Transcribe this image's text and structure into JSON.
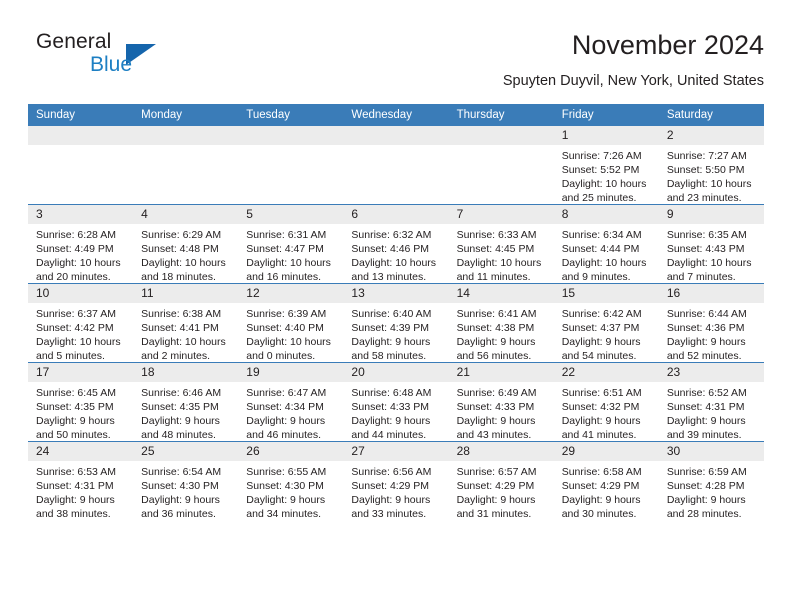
{
  "brand": {
    "name_part1": "General",
    "name_part2": "Blue",
    "triangle_icon": "triangle-icon",
    "accent_color": "#1565ac",
    "text_color": "#1d7fc3"
  },
  "header": {
    "month_title": "November 2024",
    "location": "Spuyten Duyvil, New York, United States",
    "header_bg_color": "#3a7cb8",
    "daynum_band_color": "#ececec"
  },
  "calendar": {
    "weekday_headers": [
      "Sunday",
      "Monday",
      "Tuesday",
      "Wednesday",
      "Thursday",
      "Friday",
      "Saturday"
    ],
    "weeks": [
      [
        {
          "day": "",
          "blank": true
        },
        {
          "day": "",
          "blank": true
        },
        {
          "day": "",
          "blank": true
        },
        {
          "day": "",
          "blank": true
        },
        {
          "day": "",
          "blank": true
        },
        {
          "day": "1",
          "sunrise": "Sunrise: 7:26 AM",
          "sunset": "Sunset: 5:52 PM",
          "daylight": "Daylight: 10 hours and 25 minutes."
        },
        {
          "day": "2",
          "sunrise": "Sunrise: 7:27 AM",
          "sunset": "Sunset: 5:50 PM",
          "daylight": "Daylight: 10 hours and 23 minutes."
        }
      ],
      [
        {
          "day": "3",
          "sunrise": "Sunrise: 6:28 AM",
          "sunset": "Sunset: 4:49 PM",
          "daylight": "Daylight: 10 hours and 20 minutes."
        },
        {
          "day": "4",
          "sunrise": "Sunrise: 6:29 AM",
          "sunset": "Sunset: 4:48 PM",
          "daylight": "Daylight: 10 hours and 18 minutes."
        },
        {
          "day": "5",
          "sunrise": "Sunrise: 6:31 AM",
          "sunset": "Sunset: 4:47 PM",
          "daylight": "Daylight: 10 hours and 16 minutes."
        },
        {
          "day": "6",
          "sunrise": "Sunrise: 6:32 AM",
          "sunset": "Sunset: 4:46 PM",
          "daylight": "Daylight: 10 hours and 13 minutes."
        },
        {
          "day": "7",
          "sunrise": "Sunrise: 6:33 AM",
          "sunset": "Sunset: 4:45 PM",
          "daylight": "Daylight: 10 hours and 11 minutes."
        },
        {
          "day": "8",
          "sunrise": "Sunrise: 6:34 AM",
          "sunset": "Sunset: 4:44 PM",
          "daylight": "Daylight: 10 hours and 9 minutes."
        },
        {
          "day": "9",
          "sunrise": "Sunrise: 6:35 AM",
          "sunset": "Sunset: 4:43 PM",
          "daylight": "Daylight: 10 hours and 7 minutes."
        }
      ],
      [
        {
          "day": "10",
          "sunrise": "Sunrise: 6:37 AM",
          "sunset": "Sunset: 4:42 PM",
          "daylight": "Daylight: 10 hours and 5 minutes."
        },
        {
          "day": "11",
          "sunrise": "Sunrise: 6:38 AM",
          "sunset": "Sunset: 4:41 PM",
          "daylight": "Daylight: 10 hours and 2 minutes."
        },
        {
          "day": "12",
          "sunrise": "Sunrise: 6:39 AM",
          "sunset": "Sunset: 4:40 PM",
          "daylight": "Daylight: 10 hours and 0 minutes."
        },
        {
          "day": "13",
          "sunrise": "Sunrise: 6:40 AM",
          "sunset": "Sunset: 4:39 PM",
          "daylight": "Daylight: 9 hours and 58 minutes."
        },
        {
          "day": "14",
          "sunrise": "Sunrise: 6:41 AM",
          "sunset": "Sunset: 4:38 PM",
          "daylight": "Daylight: 9 hours and 56 minutes."
        },
        {
          "day": "15",
          "sunrise": "Sunrise: 6:42 AM",
          "sunset": "Sunset: 4:37 PM",
          "daylight": "Daylight: 9 hours and 54 minutes."
        },
        {
          "day": "16",
          "sunrise": "Sunrise: 6:44 AM",
          "sunset": "Sunset: 4:36 PM",
          "daylight": "Daylight: 9 hours and 52 minutes."
        }
      ],
      [
        {
          "day": "17",
          "sunrise": "Sunrise: 6:45 AM",
          "sunset": "Sunset: 4:35 PM",
          "daylight": "Daylight: 9 hours and 50 minutes."
        },
        {
          "day": "18",
          "sunrise": "Sunrise: 6:46 AM",
          "sunset": "Sunset: 4:35 PM",
          "daylight": "Daylight: 9 hours and 48 minutes."
        },
        {
          "day": "19",
          "sunrise": "Sunrise: 6:47 AM",
          "sunset": "Sunset: 4:34 PM",
          "daylight": "Daylight: 9 hours and 46 minutes."
        },
        {
          "day": "20",
          "sunrise": "Sunrise: 6:48 AM",
          "sunset": "Sunset: 4:33 PM",
          "daylight": "Daylight: 9 hours and 44 minutes."
        },
        {
          "day": "21",
          "sunrise": "Sunrise: 6:49 AM",
          "sunset": "Sunset: 4:33 PM",
          "daylight": "Daylight: 9 hours and 43 minutes."
        },
        {
          "day": "22",
          "sunrise": "Sunrise: 6:51 AM",
          "sunset": "Sunset: 4:32 PM",
          "daylight": "Daylight: 9 hours and 41 minutes."
        },
        {
          "day": "23",
          "sunrise": "Sunrise: 6:52 AM",
          "sunset": "Sunset: 4:31 PM",
          "daylight": "Daylight: 9 hours and 39 minutes."
        }
      ],
      [
        {
          "day": "24",
          "sunrise": "Sunrise: 6:53 AM",
          "sunset": "Sunset: 4:31 PM",
          "daylight": "Daylight: 9 hours and 38 minutes."
        },
        {
          "day": "25",
          "sunrise": "Sunrise: 6:54 AM",
          "sunset": "Sunset: 4:30 PM",
          "daylight": "Daylight: 9 hours and 36 minutes."
        },
        {
          "day": "26",
          "sunrise": "Sunrise: 6:55 AM",
          "sunset": "Sunset: 4:30 PM",
          "daylight": "Daylight: 9 hours and 34 minutes."
        },
        {
          "day": "27",
          "sunrise": "Sunrise: 6:56 AM",
          "sunset": "Sunset: 4:29 PM",
          "daylight": "Daylight: 9 hours and 33 minutes."
        },
        {
          "day": "28",
          "sunrise": "Sunrise: 6:57 AM",
          "sunset": "Sunset: 4:29 PM",
          "daylight": "Daylight: 9 hours and 31 minutes."
        },
        {
          "day": "29",
          "sunrise": "Sunrise: 6:58 AM",
          "sunset": "Sunset: 4:29 PM",
          "daylight": "Daylight: 9 hours and 30 minutes."
        },
        {
          "day": "30",
          "sunrise": "Sunrise: 6:59 AM",
          "sunset": "Sunset: 4:28 PM",
          "daylight": "Daylight: 9 hours and 28 minutes."
        }
      ]
    ]
  }
}
